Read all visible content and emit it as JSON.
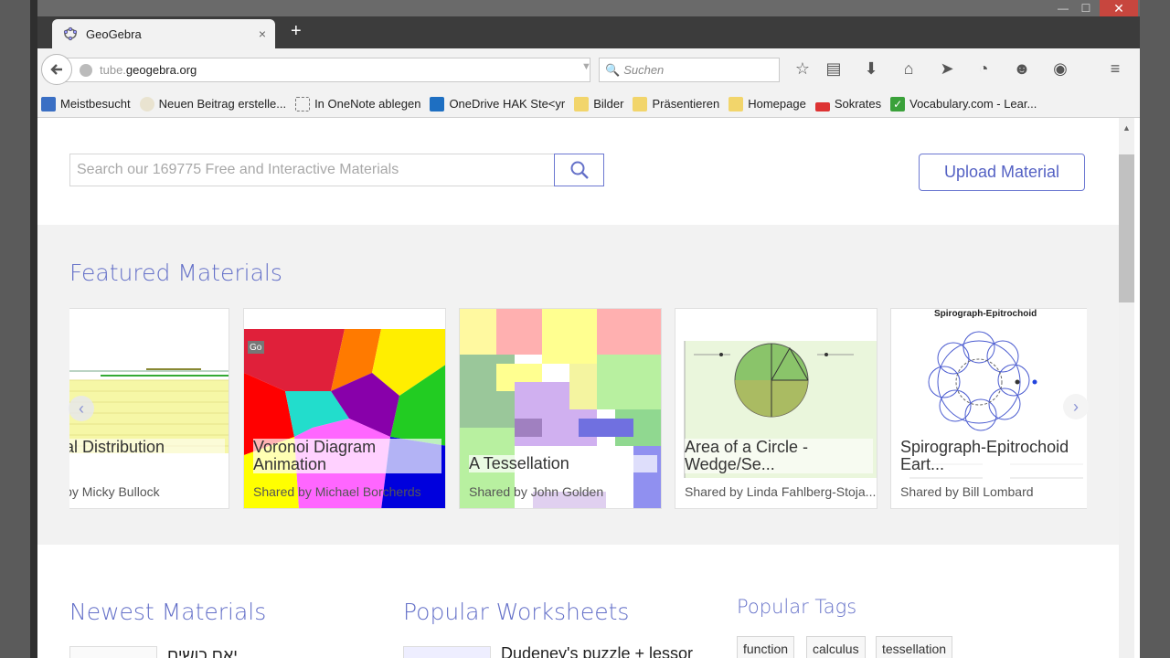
{
  "window": {
    "min_label": "—",
    "max_label": "☐",
    "close_label": "✕"
  },
  "tabs": [
    {
      "title": "GeoGebra",
      "close": "×"
    }
  ],
  "newtab_label": "+",
  "navbar": {
    "url_host": "tube.",
    "url_domain": "geogebra.org",
    "search_placeholder": "Suchen"
  },
  "bookmarks": [
    {
      "label": "Meistbesucht",
      "color": "#3a6fc4"
    },
    {
      "label": "Neuen Beitrag erstelle...",
      "color": "#e9e3d0"
    },
    {
      "label": "In OneNote ablegen",
      "color": "#ffffff"
    },
    {
      "label": "OneDrive HAK Ste<yr",
      "color": "#1e6fc2"
    },
    {
      "label": "Bilder",
      "color": "#f2d56b"
    },
    {
      "label": "Präsentieren",
      "color": "#f2d56b"
    },
    {
      "label": "Homepage",
      "color": "#f2d56b"
    },
    {
      "label": "Sokrates",
      "color": "#d33"
    },
    {
      "label": "Vocabulary.com - Lear...",
      "color": "#3aa13a"
    }
  ],
  "page": {
    "search_placeholder": "Search our 169775 Free and Interactive Materials",
    "upload_label": "Upload Material",
    "featured_title": "Featured Materials",
    "featured": [
      {
        "title": "...ural Distribution\n...",
        "shared_by": "...ed by Micky Bullock"
      },
      {
        "title": "Voronoi Diagram Animation",
        "shared_by": "Shared by Michael Borcherds"
      },
      {
        "title": "A Tessellation",
        "shared_by": "Shared by John Golden"
      },
      {
        "title": "Area of a Circle - Wedge/Se...",
        "shared_by": "Shared by Linda Fahlberg-Stoja..."
      },
      {
        "title": "Spirograph-Epitrochoid Eart...",
        "shared_by": "Shared by Bill Lombard"
      }
    ],
    "spirograph_caption": "Spirograph-Epitrochoid",
    "voronoi_badge": "Go",
    "newest_title": "Newest Materials",
    "newest_first": "יאם כושים",
    "popular_ws_title": "Popular Worksheets",
    "popular_first": "Dudeney's puzzle + lessor",
    "tags_title": "Popular Tags",
    "tags": [
      "function",
      "calculus",
      "tessellation"
    ]
  }
}
